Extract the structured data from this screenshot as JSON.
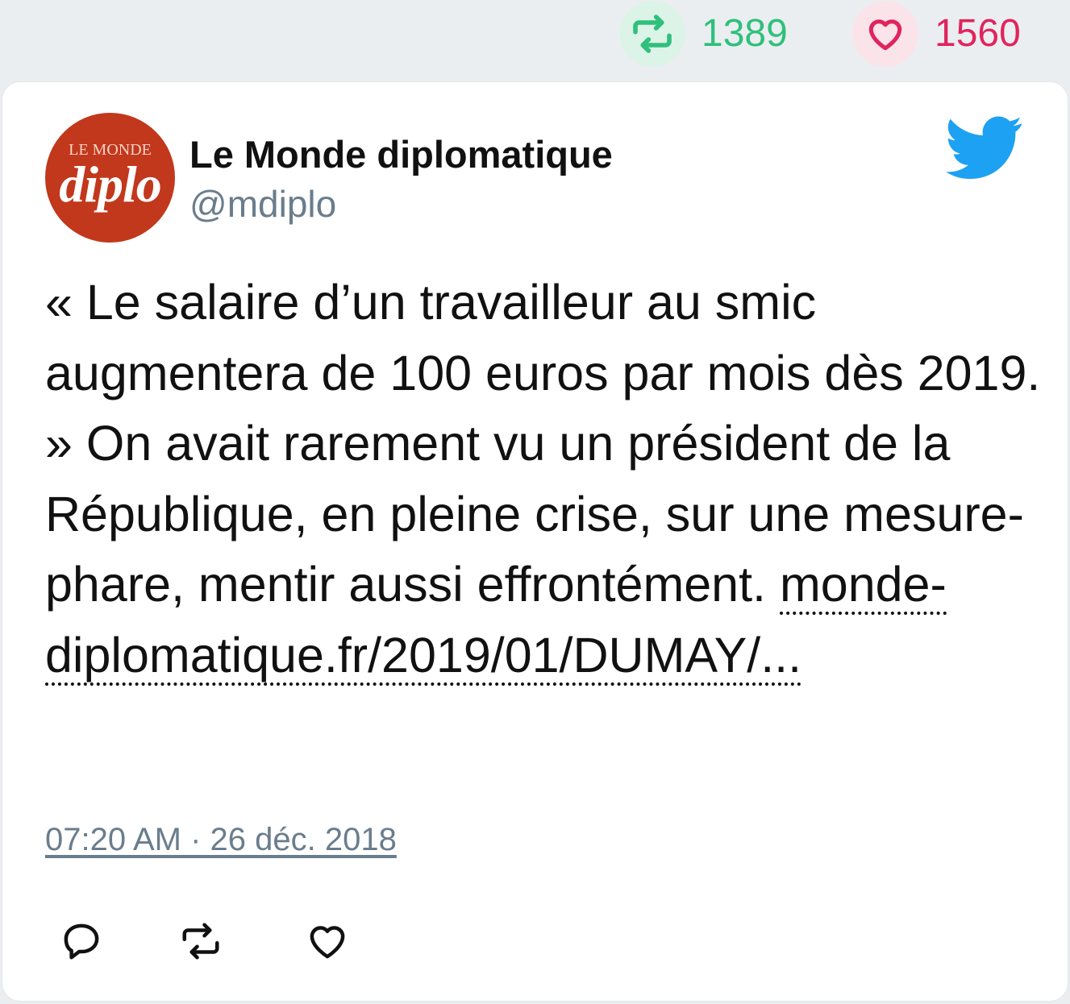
{
  "stats": {
    "retweet_count": "1389",
    "like_count": "1560",
    "retweet_icon": "retweet-icon",
    "like_icon": "heart-icon",
    "retweet_color": "#2fc07c",
    "like_color": "#e0245e"
  },
  "tweet": {
    "author": {
      "name": "Le Monde diplomatique",
      "handle": "@mdiplo",
      "avatar_text_top": "LE MONDE",
      "avatar_text_main": "diplo"
    },
    "text": "« Le salaire d’un travailleur au smic augmentera de 100 euros par mois dès 2019. » On avait rarement vu un président de la République, en pleine crise, sur une mesure-phare, mentir aussi effrontément.",
    "link": "monde-diplomatique.fr/2019/01/DUMAY/...",
    "timestamp": "07:20 AM · 26 déc. 2018",
    "brand_icon": "twitter-bird-icon",
    "brand_color": "#1da1f2"
  },
  "actions": {
    "reply_icon": "reply-icon",
    "retweet_icon": "retweet-icon",
    "like_icon": "heart-icon"
  }
}
